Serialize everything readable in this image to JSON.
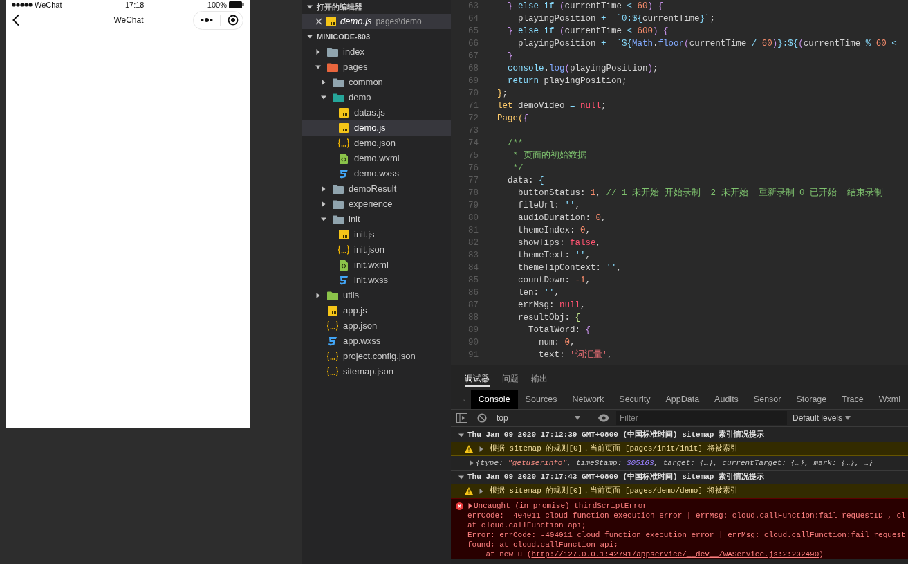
{
  "simulator": {
    "status_bar": {
      "carrier": "WeChat",
      "time": "17:18",
      "battery": "100%"
    },
    "nav_title": "WeChat"
  },
  "explorer": {
    "open_editors": {
      "title": "打开的编辑器",
      "expanded": true,
      "items": [
        {
          "name": "demo.js",
          "path": "pages\\demo",
          "kind": "js",
          "selected": true
        }
      ]
    },
    "project": {
      "title": "MINICODE-803",
      "expanded": true,
      "children": [
        {
          "name": "index",
          "kind": "folder",
          "color": "#90a4ae",
          "expanded": false,
          "selected": false
        },
        {
          "name": "pages",
          "kind": "folder",
          "color": "#e8663d",
          "expanded": true,
          "selected": false,
          "children": [
            {
              "name": "common",
              "kind": "folder",
              "color": "#90a4ae",
              "expanded": false,
              "selected": false
            },
            {
              "name": "demo",
              "kind": "folder",
              "color": "#26a69a",
              "expanded": true,
              "selected": false,
              "children": [
                {
                  "name": "datas.js",
                  "kind": "js",
                  "selected": false
                },
                {
                  "name": "demo.js",
                  "kind": "js",
                  "selected": true
                },
                {
                  "name": "demo.json",
                  "kind": "json",
                  "selected": false
                },
                {
                  "name": "demo.wxml",
                  "kind": "wxml",
                  "selected": false
                },
                {
                  "name": "demo.wxss",
                  "kind": "wxss",
                  "selected": false
                }
              ]
            },
            {
              "name": "demoResult",
              "kind": "folder",
              "color": "#90a4ae",
              "expanded": false,
              "selected": false
            },
            {
              "name": "experience",
              "kind": "folder",
              "color": "#90a4ae",
              "expanded": false,
              "selected": false
            },
            {
              "name": "init",
              "kind": "folder",
              "color": "#90a4ae",
              "expanded": true,
              "selected": false,
              "children": [
                {
                  "name": "init.js",
                  "kind": "js",
                  "selected": false
                },
                {
                  "name": "init.json",
                  "kind": "json",
                  "selected": false
                },
                {
                  "name": "init.wxml",
                  "kind": "wxml",
                  "selected": false
                },
                {
                  "name": "init.wxss",
                  "kind": "wxss",
                  "selected": false
                }
              ]
            }
          ]
        },
        {
          "name": "utils",
          "kind": "folder",
          "color": "#8bc34a",
          "expanded": false,
          "selected": false
        },
        {
          "name": "app.js",
          "kind": "js",
          "selected": false
        },
        {
          "name": "app.json",
          "kind": "json",
          "selected": false
        },
        {
          "name": "app.wxss",
          "kind": "wxss",
          "selected": false
        },
        {
          "name": "project.config.json",
          "kind": "json",
          "selected": false
        },
        {
          "name": "sitemap.json",
          "kind": "json",
          "selected": false
        }
      ]
    }
  },
  "editor": {
    "lines": [
      {
        "number": "63",
        "tokens": [
          {
            "t": "  }",
            "kind": "brace"
          },
          {
            "t": " else if ",
            "kind": "keyword"
          },
          {
            "t": "(",
            "kind": "brace"
          },
          {
            "t": "currentTime "
          },
          {
            "t": "<",
            "kind": "keyword"
          },
          {
            "t": " 60",
            "kind": "number"
          },
          {
            "t": ") {",
            "kind": "brace"
          }
        ]
      },
      {
        "number": "64",
        "tokens": [
          {
            "t": "    playingPosition "
          },
          {
            "t": "+=",
            "kind": "keyword"
          },
          {
            "t": " `0:${",
            "kind": "template"
          },
          {
            "t": "currentTime"
          },
          {
            "t": "}`",
            "kind": "template"
          },
          {
            "t": ";"
          }
        ]
      },
      {
        "number": "65",
        "tokens": [
          {
            "t": "  }",
            "kind": "brace"
          },
          {
            "t": " else if ",
            "kind": "keyword"
          },
          {
            "t": "(",
            "kind": "brace"
          },
          {
            "t": "currentTime "
          },
          {
            "t": "<",
            "kind": "keyword"
          },
          {
            "t": " 600",
            "kind": "number"
          },
          {
            "t": ") {",
            "kind": "brace"
          }
        ]
      },
      {
        "number": "66",
        "tokens": [
          {
            "t": "    playingPosition "
          },
          {
            "t": "+=",
            "kind": "keyword"
          },
          {
            "t": " `${",
            "kind": "template"
          },
          {
            "t": "Math",
            "kind": "func"
          },
          {
            "t": "."
          },
          {
            "t": "floor",
            "kind": "func"
          },
          {
            "t": "(",
            "kind": "brace"
          },
          {
            "t": "currentTime "
          },
          {
            "t": "/",
            "kind": "keyword"
          },
          {
            "t": " 60",
            "kind": "number"
          },
          {
            "t": ")",
            "kind": "brace"
          },
          {
            "t": "}:${",
            "kind": "template"
          },
          {
            "t": "(",
            "kind": "brace"
          },
          {
            "t": "currentTime "
          },
          {
            "t": "%",
            "kind": "keyword"
          },
          {
            "t": " 60",
            "kind": "number"
          },
          {
            "t": " <",
            "kind": "keyword"
          }
        ]
      },
      {
        "number": "67",
        "tokens": [
          {
            "t": "  }",
            "kind": "brace"
          }
        ]
      },
      {
        "number": "68",
        "tokens": [
          {
            "t": "  console",
            "kind": "keyword"
          },
          {
            "t": "."
          },
          {
            "t": "log",
            "kind": "func"
          },
          {
            "t": "(",
            "kind": "brace"
          },
          {
            "t": "playingPosition"
          },
          {
            "t": ")",
            "kind": "brace"
          },
          {
            "t": ";"
          }
        ]
      },
      {
        "number": "69",
        "tokens": [
          {
            "t": "  return",
            "kind": "keyword"
          },
          {
            "t": " playingPosition;"
          }
        ]
      },
      {
        "number": "70",
        "tokens": [
          {
            "t": "}",
            "kind": "class"
          },
          {
            "t": ";"
          }
        ]
      },
      {
        "number": "71",
        "tokens": [
          {
            "t": "let",
            "kind": "class"
          },
          {
            "t": " demoVideo "
          },
          {
            "t": "=",
            "kind": "keyword"
          },
          {
            "t": " null",
            "kind": "const"
          },
          {
            "t": ";"
          }
        ]
      },
      {
        "number": "72",
        "tokens": [
          {
            "t": "Page(",
            "kind": "class"
          },
          {
            "t": "{",
            "kind": "brace"
          }
        ]
      },
      {
        "number": "73"
      },
      {
        "number": "74",
        "tokens": [
          {
            "t": "  /**",
            "kind": "comment"
          }
        ]
      },
      {
        "number": "75",
        "tokens": [
          {
            "t": "   * 页面的初始数据",
            "kind": "comment"
          }
        ]
      },
      {
        "number": "76",
        "tokens": [
          {
            "t": "   */",
            "kind": "comment"
          }
        ]
      },
      {
        "number": "77",
        "tokens": [
          {
            "t": "  data: "
          },
          {
            "t": "{",
            "kind": "template"
          }
        ]
      },
      {
        "number": "78",
        "tokens": [
          {
            "t": "    buttonStatus: "
          },
          {
            "t": "1",
            "kind": "number"
          },
          {
            "t": ", "
          },
          {
            "t": "// 1 未开始 开始录制  2 未开始  重新录制 0 已开始  结束录制",
            "kind": "comment"
          }
        ]
      },
      {
        "number": "79",
        "tokens": [
          {
            "t": "    fileUrl: "
          },
          {
            "t": "''",
            "kind": "template"
          },
          {
            "t": ","
          }
        ]
      },
      {
        "number": "80",
        "tokens": [
          {
            "t": "    audioDuration: "
          },
          {
            "t": "0",
            "kind": "number"
          },
          {
            "t": ","
          }
        ]
      },
      {
        "number": "81",
        "tokens": [
          {
            "t": "    themeIndex: "
          },
          {
            "t": "0",
            "kind": "number"
          },
          {
            "t": ","
          }
        ]
      },
      {
        "number": "82",
        "tokens": [
          {
            "t": "    showTips: "
          },
          {
            "t": "false",
            "kind": "const"
          },
          {
            "t": ","
          }
        ]
      },
      {
        "number": "83",
        "tokens": [
          {
            "t": "    themeText: "
          },
          {
            "t": "''",
            "kind": "template"
          },
          {
            "t": ","
          }
        ]
      },
      {
        "number": "84",
        "tokens": [
          {
            "t": "    themeTipContext: "
          },
          {
            "t": "''",
            "kind": "template"
          },
          {
            "t": ","
          }
        ]
      },
      {
        "number": "85",
        "tokens": [
          {
            "t": "    countDown: "
          },
          {
            "t": "-1",
            "kind": "number"
          },
          {
            "t": ","
          }
        ]
      },
      {
        "number": "86",
        "tokens": [
          {
            "t": "    len: "
          },
          {
            "t": "''",
            "kind": "template"
          },
          {
            "t": ","
          }
        ]
      },
      {
        "number": "87",
        "tokens": [
          {
            "t": "    errMsg: "
          },
          {
            "t": "null",
            "kind": "const"
          },
          {
            "t": ","
          }
        ]
      },
      {
        "number": "88",
        "tokens": [
          {
            "t": "    resultObj: "
          },
          {
            "t": "{",
            "kind": "green"
          }
        ]
      },
      {
        "number": "89",
        "tokens": [
          {
            "t": "      TotalWord: "
          },
          {
            "t": "{",
            "kind": "brace"
          }
        ]
      },
      {
        "number": "90",
        "tokens": [
          {
            "t": "        num: "
          },
          {
            "t": "0",
            "kind": "number"
          },
          {
            "t": ","
          }
        ]
      },
      {
        "number": "91",
        "tokens": [
          {
            "t": "        text: "
          },
          {
            "t": "'词汇量'",
            "kind": "string"
          },
          {
            "t": ","
          }
        ]
      }
    ]
  },
  "panel_tabs": [
    {
      "label": "调试器",
      "selected": true
    },
    {
      "label": "问题",
      "selected": false
    },
    {
      "label": "输出",
      "selected": false
    }
  ],
  "devtools_tabs": [
    {
      "label": "Console",
      "selected": true
    },
    {
      "label": "Sources",
      "selected": false
    },
    {
      "label": "Network",
      "selected": false
    },
    {
      "label": "Security",
      "selected": false
    },
    {
      "label": "AppData",
      "selected": false
    },
    {
      "label": "Audits",
      "selected": false
    },
    {
      "label": "Sensor",
      "selected": false
    },
    {
      "label": "Storage",
      "selected": false
    },
    {
      "label": "Trace",
      "selected": false
    },
    {
      "label": "Wxml",
      "selected": false
    }
  ],
  "console_toolbar": {
    "context": "top",
    "filter_placeholder": "Filter",
    "levels": "Default levels"
  },
  "console": [
    {
      "kind": "group",
      "expanded": true,
      "text": "Thu Jan 09 2020 17:12:39 GMT+0800 (中国标准时间) sitemap 索引情况提示"
    },
    {
      "kind": "warning",
      "expanded": false,
      "text": "根据 sitemap 的规则[0]，当前页面 [pages/init/init] 将被索引"
    },
    {
      "kind": "object",
      "expanded": false,
      "parts": [
        {
          "t": "{"
        },
        {
          "t": "type",
          "kind": "key"
        },
        {
          "t": ": "
        },
        {
          "t": "\"getuserinfo\"",
          "kind": "string"
        },
        {
          "t": ", "
        },
        {
          "t": "timeStamp",
          "kind": "key"
        },
        {
          "t": ": "
        },
        {
          "t": "305163",
          "kind": "number"
        },
        {
          "t": ", "
        },
        {
          "t": "target",
          "kind": "key"
        },
        {
          "t": ": {…}, "
        },
        {
          "t": "currentTarget",
          "kind": "key"
        },
        {
          "t": ": {…}, "
        },
        {
          "t": "mark",
          "kind": "key"
        },
        {
          "t": ": {…}, …}"
        }
      ]
    },
    {
      "kind": "group",
      "expanded": true,
      "text": "Thu Jan 09 2020 17:17:43 GMT+0800 (中国标准时间) sitemap 索引情况提示"
    },
    {
      "kind": "warning",
      "expanded": false,
      "text": "根据 sitemap 的规则[0]，当前页面 [pages/demo/demo] 将被索引"
    },
    {
      "kind": "error",
      "expanded": false,
      "text": "Uncaught (in promise) thirdScriptError",
      "lines": [
        "errCode: -404011 cloud function execution error | errMsg: cloud.callFunction:fail requestID , cl",
        "at cloud.callFunction api;",
        "Error: errCode: -404011 cloud function execution error | errMsg: cloud.callFunction:fail request",
        "found; at cloud.callFunction api;"
      ],
      "stack": {
        "before": "    at new u (",
        "link": "http://127.0.0.1:42791/appservice/__dev__/WAService.js:2:202490",
        "after": ")"
      }
    }
  ]
}
